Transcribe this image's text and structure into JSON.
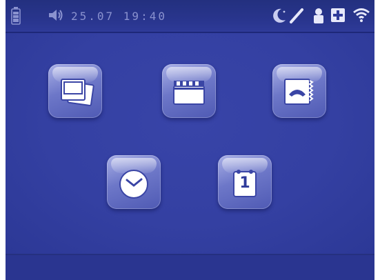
{
  "status_bar": {
    "datetime": "25.07 19:40",
    "icons": [
      "battery-icon",
      "speaker-icon",
      "night-mode-icon",
      "edit-icon",
      "intercom-icon",
      "medical-cross-icon",
      "wifi-icon"
    ]
  },
  "apps": [
    {
      "icon": "photo-gallery-icon"
    },
    {
      "icon": "video-clapper-icon"
    },
    {
      "icon": "intercom-phone-icon"
    },
    {
      "icon": "clock-icon"
    },
    {
      "icon": "calendar-icon",
      "glyph": "1"
    }
  ],
  "colors": {
    "background": "#2f3b9a",
    "status_text": "#8a92cf",
    "tile_light": "#a9b0e6",
    "tile_dark": "#4f5ab4"
  }
}
